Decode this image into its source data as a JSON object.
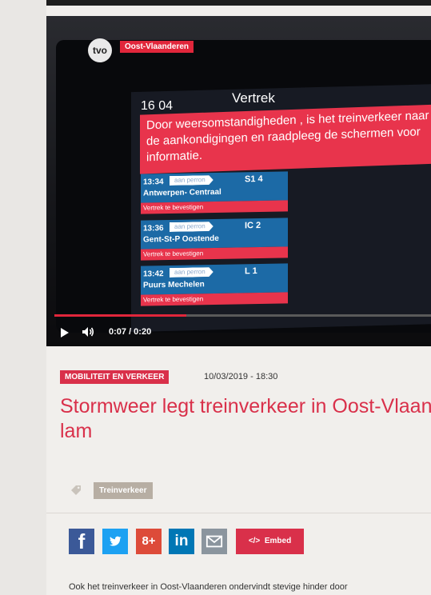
{
  "video": {
    "channel_logo": "tvo",
    "region_label": "Oost-Vlaanderen",
    "screen": {
      "time": "16 04",
      "title": "Vertrek",
      "alert": "Door weersomstandigheden , is het treinverkeer naar de aankondigingen en raadpleeg de schermen voor informatie.",
      "departures": [
        {
          "time": "13:34",
          "perron": "aan perron",
          "train": "S1 4",
          "destination": "Antwerpen- Centraal",
          "status": "Vertrek te bevestigen"
        },
        {
          "time": "13:36",
          "perron": "aan perron",
          "train": "IC 2",
          "destination": "Gent-St-P Oostende",
          "status": "Vertrek te bevestigen"
        },
        {
          "time": "13:42",
          "perron": "aan perron",
          "train": "L 1",
          "destination": "Puurs Mechelen",
          "status": "Vertrek te bevestigen"
        }
      ]
    },
    "timecode": "0:07 / 0:20",
    "progress_fraction": 0.35
  },
  "article": {
    "category": "MOBILITEIT EN VERKEER",
    "date": "10/03/2019 - 18:30",
    "headline": "Stormweer legt treinverkeer in Oost-Vlaanderen lam",
    "tag": "Treinverkeer",
    "embed_label": "Embed",
    "embed_icon": "</>",
    "body_start": "Ook het treinverkeer in Oost-Vlaanderen ondervindt stevige hinder door"
  },
  "share": {
    "facebook": "f",
    "googleplus": "8+",
    "linkedin": "in"
  },
  "colors": {
    "accent": "#d9304a",
    "tag_bg": "#b7aea3"
  }
}
